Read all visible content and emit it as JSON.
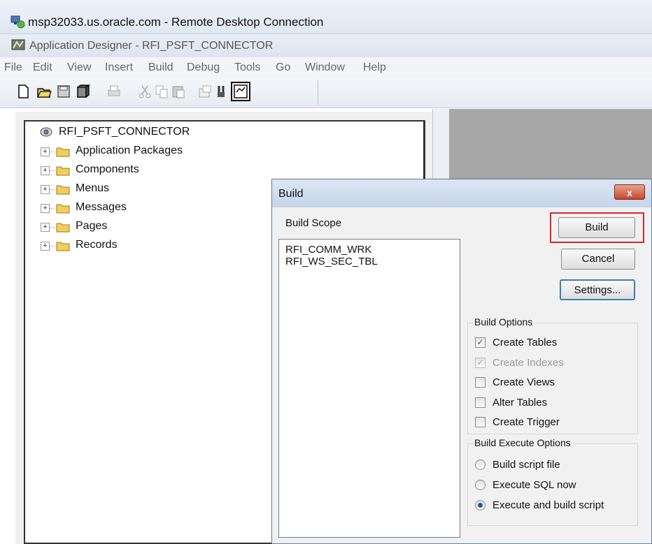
{
  "rdp": {
    "title": "msp32033.us.oracle.com - Remote Desktop Connection"
  },
  "app": {
    "title": "Application Designer - RFI_PSFT_CONNECTOR"
  },
  "menu": [
    "File",
    "Edit",
    "View",
    "Insert",
    "Build",
    "Debug",
    "Tools",
    "Go",
    "Window",
    "Help"
  ],
  "toolbar": {
    "icons": [
      "new-icon",
      "open-icon",
      "save-icon",
      "save-all-icon",
      "print-icon",
      "cut-icon",
      "copy-icon",
      "paste-icon",
      "properties-icon",
      "find-icon",
      "project-workspace-icon"
    ]
  },
  "tree": {
    "root": "RFI_PSFT_CONNECTOR",
    "items": [
      "Application Packages",
      "Components",
      "Menus",
      "Messages",
      "Pages",
      "Records"
    ]
  },
  "dialog": {
    "title": "Build",
    "close_label": "x",
    "scope_label": "Build Scope",
    "scope_items": [
      "RFI_COMM_WRK",
      "RFI_WS_SEC_TBL"
    ],
    "buttons": {
      "build": "Build",
      "cancel": "Cancel",
      "settings": "Settings..."
    },
    "build_options": {
      "title": "Build Options",
      "items": [
        {
          "label": "Create Tables",
          "checked": true,
          "enabled": true
        },
        {
          "label": "Create Indexes",
          "checked": true,
          "enabled": false
        },
        {
          "label": "Create Views",
          "checked": false,
          "enabled": true
        },
        {
          "label": "Alter Tables",
          "checked": false,
          "enabled": true
        },
        {
          "label": "Create Trigger",
          "checked": false,
          "enabled": true
        }
      ]
    },
    "execute_options": {
      "title": "Build Execute Options",
      "items": [
        {
          "label": "Build script file",
          "selected": false
        },
        {
          "label": "Execute SQL now",
          "selected": false
        },
        {
          "label": "Execute and build script",
          "selected": true
        }
      ]
    }
  },
  "colors": {
    "highlight": "#d2282e",
    "radio_dot": "#1f55a8",
    "close_button": "#c8462b",
    "right_pane": "#a7a7a7"
  }
}
